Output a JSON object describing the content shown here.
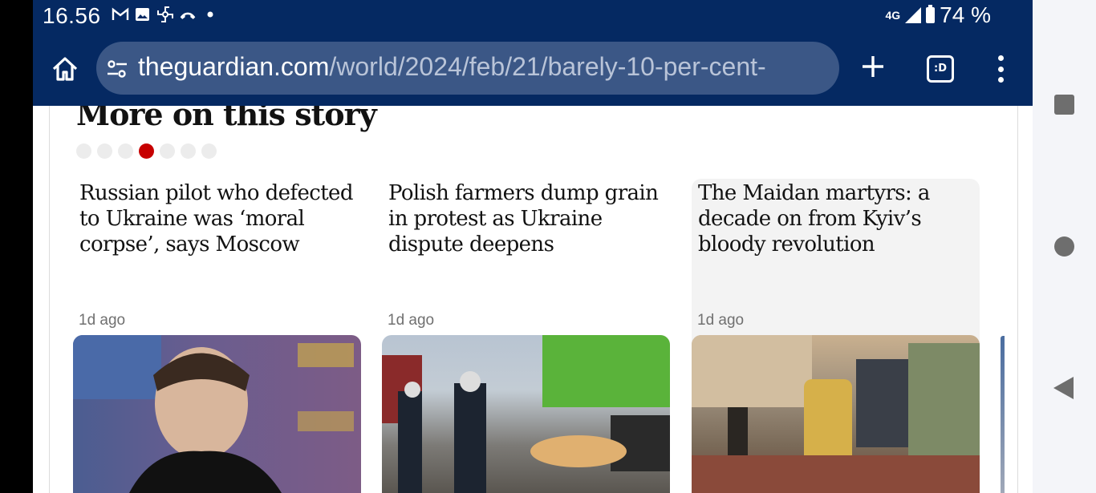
{
  "status_bar": {
    "time": "16.56",
    "notification_icons": [
      "gmail-icon",
      "image-icon",
      "pinwheel-icon",
      "missed-call-icon",
      "dot-icon"
    ],
    "network": "4G",
    "battery": "74 %"
  },
  "browser": {
    "url_host": "theguardian.com",
    "url_path": "/world/2024/feb/21/barely-10-per-cent-",
    "tabs_label": ":D",
    "icons": {
      "home": "home-icon",
      "site_settings": "tune-icon",
      "new_tab": "plus-icon",
      "tabs": "tab-switcher-icon",
      "menu": "more-vert-icon"
    }
  },
  "section": {
    "title": "More on this story",
    "carousel_dots": 7,
    "active_dot": 4
  },
  "cards": [
    {
      "headline": "Russian pilot who defected to Ukraine was ‘moral corpse’, says Moscow",
      "time": "1d ago"
    },
    {
      "headline": "Polish farmers dump grain in protest as Ukraine dispute deepens",
      "time": "1d ago"
    },
    {
      "headline": "The Maidan martyrs: a decade on from Kyiv’s bloody revolution",
      "time": "1d ago"
    }
  ],
  "nav_bar": {
    "buttons": [
      "recents-button",
      "home-button",
      "back-button"
    ]
  },
  "colors": {
    "guardian_blue": "#052962",
    "url_bar": "#3b5786",
    "active_dot": "#c70000"
  }
}
